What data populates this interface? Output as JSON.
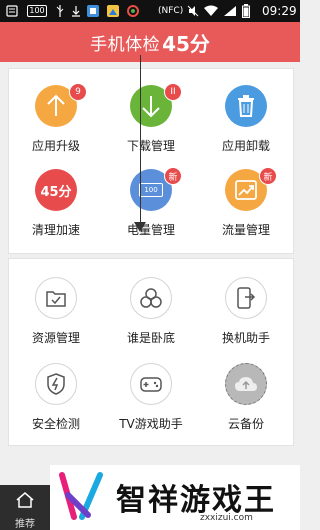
{
  "status_bar": {
    "signal_badge": "100",
    "nfc": "(NFC)",
    "battery_level": 0.95,
    "time": "09:29"
  },
  "header": {
    "title": "手机体检",
    "score": "45分"
  },
  "tools_top": [
    {
      "label": "应用升级",
      "icon": "arrow-up-icon",
      "color": "#f5a742",
      "badge": "9"
    },
    {
      "label": "下载管理",
      "icon": "arrow-down-icon",
      "color": "#6ab43a",
      "badge": "II"
    },
    {
      "label": "应用卸载",
      "icon": "trash-icon",
      "color": "#4a9be0",
      "badge": ""
    },
    {
      "label": "清理加速",
      "icon": "score-icon",
      "color": "#e84b4b",
      "icon_text": "45分",
      "badge": ""
    },
    {
      "label": "电量管理",
      "icon": "battery-icon",
      "color": "#5b8fd9",
      "icon_text": "100",
      "badge": "新"
    },
    {
      "label": "流量管理",
      "icon": "chart-icon",
      "color": "#f5a742",
      "badge": "新"
    }
  ],
  "tools_bottom": [
    {
      "label": "资源管理",
      "icon": "folder-icon"
    },
    {
      "label": "谁是卧底",
      "icon": "group-icon"
    },
    {
      "label": "换机助手",
      "icon": "phone-transfer-icon"
    },
    {
      "label": "安全检测",
      "icon": "shield-icon"
    },
    {
      "label": "TV游戏助手",
      "icon": "gamepad-icon"
    },
    {
      "label": "云备份",
      "icon": "cloud-upload-icon"
    }
  ],
  "bottom_nav": {
    "label": "推荐"
  },
  "watermark": {
    "brand": "智祥游戏王",
    "url": "zxxizui.com"
  },
  "colors": {
    "header": "#e85a5a",
    "badge": "#e84b4b"
  }
}
